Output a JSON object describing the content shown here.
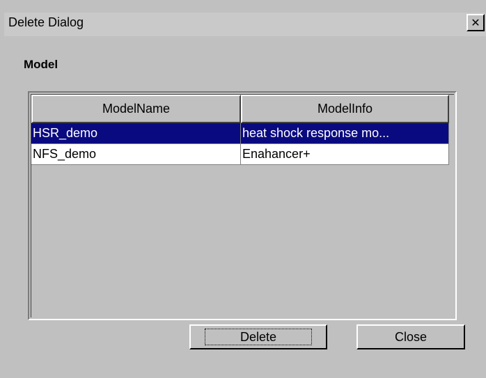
{
  "window": {
    "title": "Delete Dialog",
    "close_glyph": "✕"
  },
  "section": {
    "label": "Model"
  },
  "table": {
    "columns": [
      "ModelName",
      "ModelInfo"
    ],
    "rows": [
      {
        "name": "HSR_demo",
        "info": "heat shock response mo...",
        "selected": true
      },
      {
        "name": "NFS_demo",
        "info": "Enahancer+",
        "selected": false
      }
    ]
  },
  "buttons": {
    "delete": "Delete",
    "close": "Close"
  },
  "colors": {
    "selection": "#0a0a80",
    "face": "#c0c0c0"
  }
}
